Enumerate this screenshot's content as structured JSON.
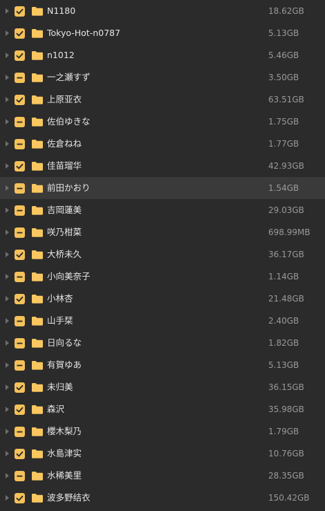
{
  "colors": {
    "background": "#2b2b2b",
    "hover_row": "#3a3a3a",
    "checkbox": "#f5c15a",
    "folder": "#f8c760",
    "name_text": "#e6e6e6",
    "size_text": "#9a9a9a"
  },
  "icons": {
    "expand": "chevron-right-icon",
    "folder": "folder-icon",
    "checked": "check-icon",
    "partial": "minus-icon"
  },
  "items": [
    {
      "name": "N1180",
      "size": "18.62GB",
      "state": "checked"
    },
    {
      "name": "Tokyo-Hot-n0787",
      "size": "5.13GB",
      "state": "checked"
    },
    {
      "name": "n1012",
      "size": "5.46GB",
      "state": "checked"
    },
    {
      "name": "一之瀬すず",
      "size": "3.50GB",
      "state": "partial"
    },
    {
      "name": "上原亚衣",
      "size": "63.51GB",
      "state": "checked"
    },
    {
      "name": "佐伯ゆきな",
      "size": "1.75GB",
      "state": "partial"
    },
    {
      "name": "佐倉ねね",
      "size": "1.77GB",
      "state": "partial"
    },
    {
      "name": "佳苗瑠华",
      "size": "42.93GB",
      "state": "checked"
    },
    {
      "name": "前田かおり",
      "size": "1.54GB",
      "state": "partial",
      "hover": true
    },
    {
      "name": "吉岡蓮美",
      "size": "29.03GB",
      "state": "partial"
    },
    {
      "name": "咲乃柑菜",
      "size": "698.99MB",
      "state": "partial"
    },
    {
      "name": "大桥未久",
      "size": "36.17GB",
      "state": "checked"
    },
    {
      "name": "小向美奈子",
      "size": "1.14GB",
      "state": "partial"
    },
    {
      "name": "小林杏",
      "size": "21.48GB",
      "state": "checked"
    },
    {
      "name": "山手栞",
      "size": "2.40GB",
      "state": "partial"
    },
    {
      "name": "日向るな",
      "size": "1.82GB",
      "state": "partial"
    },
    {
      "name": "有賀ゆあ",
      "size": "5.13GB",
      "state": "partial"
    },
    {
      "name": "未归美",
      "size": "36.15GB",
      "state": "checked"
    },
    {
      "name": "森沢",
      "size": "35.98GB",
      "state": "checked"
    },
    {
      "name": "櫻木梨乃",
      "size": "1.79GB",
      "state": "partial"
    },
    {
      "name": "水島津实",
      "size": "10.76GB",
      "state": "checked"
    },
    {
      "name": "水稀美里",
      "size": "28.35GB",
      "state": "partial"
    },
    {
      "name": "波多野结衣",
      "size": "150.42GB",
      "state": "checked"
    }
  ]
}
